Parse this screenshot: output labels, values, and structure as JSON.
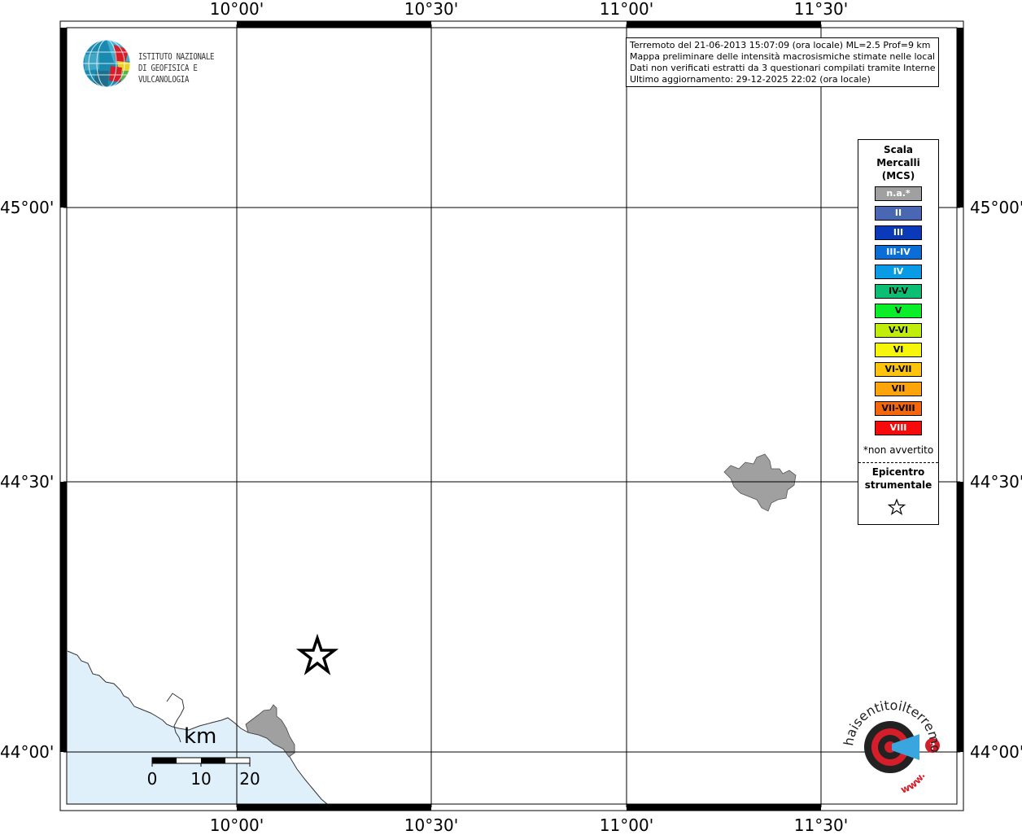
{
  "map": {
    "lon_ticks": [
      "10°00'",
      "10°30'",
      "11°00'",
      "11°30'"
    ],
    "lat_ticks": [
      "45°00'",
      "44°30'",
      "44°00'"
    ],
    "water_color": "#dff0fb",
    "city_color": "#a0a0a0",
    "grid_color": "#000000"
  },
  "info": {
    "line1": "Terremoto del 21-06-2013 15:07:09 (ora locale) ML=2.5 Prof=9 km",
    "line2": "Mappa preliminare delle intensità macrosismiche stimate nelle località",
    "line3": "Dati non verificati estratti da 3 questionari compilati tramite Internet.",
    "line4": "Ultimo aggiornamento: 29-12-2025 22:02 (ora locale)"
  },
  "logo": {
    "line1": "ISTITUTO NAZIONALE",
    "line2": "DI GEOFISICA E VULCANOLOGIA"
  },
  "legend": {
    "title1": "Scala",
    "title2": "Mercalli",
    "title3": "(MCS)",
    "items": [
      {
        "label": "n.a.*",
        "color": "#a0a0a0",
        "text_color": "#ffffff"
      },
      {
        "label": "II",
        "color": "#4a67b4",
        "text_color": "#ffffff"
      },
      {
        "label": "III",
        "color": "#0a3aba",
        "text_color": "#ffffff"
      },
      {
        "label": "III-IV",
        "color": "#0a6ed6",
        "text_color": "#ffffff"
      },
      {
        "label": "IV",
        "color": "#0a9be6",
        "text_color": "#ffffff"
      },
      {
        "label": "IV-V",
        "color": "#0abf74",
        "text_color": "#000000"
      },
      {
        "label": "V",
        "color": "#0aee2a",
        "text_color": "#000000"
      },
      {
        "label": "V-VI",
        "color": "#c0ee0a",
        "text_color": "#000000"
      },
      {
        "label": "VI",
        "color": "#f6f60a",
        "text_color": "#000000"
      },
      {
        "label": "VI-VII",
        "color": "#fcc40a",
        "text_color": "#000000"
      },
      {
        "label": "VII",
        "color": "#fca40a",
        "text_color": "#000000"
      },
      {
        "label": "VII-VIII",
        "color": "#f6660a",
        "text_color": "#000000"
      },
      {
        "label": "VIII",
        "color": "#f60a0a",
        "text_color": "#ffffff"
      }
    ],
    "note": "*non avvertito",
    "epic1": "Epicentro",
    "epic2": "strumentale"
  },
  "scalebar": {
    "unit": "km",
    "labels": [
      "0",
      "10",
      "20"
    ]
  },
  "hst_logo": {
    "text": "haisentitoilterremoto.it",
    "www": "www.",
    "q": "?"
  }
}
